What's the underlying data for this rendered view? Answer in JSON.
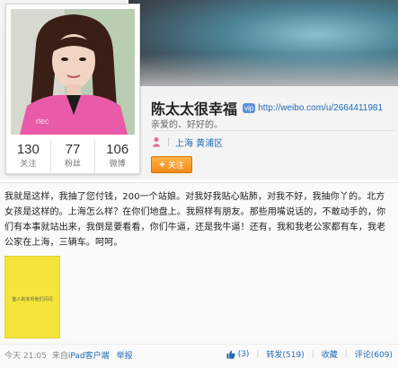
{
  "profile": {
    "name": "陈太太很幸福",
    "verified_badge": "vip",
    "weibo_url": "http://weibo.com/u/2664411981",
    "bio": "亲爱的、好好的。",
    "location": "上海 黄浦区",
    "follow_label": "关注",
    "stats": [
      {
        "value": "130",
        "label": "关注"
      },
      {
        "value": "77",
        "label": "粉丝"
      },
      {
        "value": "106",
        "label": "微博"
      }
    ]
  },
  "post": {
    "text": "我就是这样，我抽了您付钱，200一个站娘。对我好我贴心贴肺，对我不好，我抽你丫的。北方女孩是这样的。上海怎么样？在你们地盘上。我照样有朋友。那些用嘴说话的，不敢动手的，你们有本事就站出来，我倒是要看看，你们牛逼，还是我牛逼！还有，我和我老公家都有车，我老公家在上海，三辆车。呵呵。",
    "image_caption": "能人的本币他们闪闪",
    "time": "今天 21:05",
    "source_prefix": "来自",
    "source": "iPad客户端",
    "report": "举报",
    "likes": "(3)",
    "repost": "转发(519)",
    "favorite": "收藏",
    "comment": "评论(609)"
  },
  "colors": {
    "link": "#1f6bb5",
    "follow_button": "#f08a16",
    "thumbnail": "#f5e53a"
  },
  "icons": [
    "person-icon",
    "thumbs-up-icon",
    "verified-icon"
  ]
}
